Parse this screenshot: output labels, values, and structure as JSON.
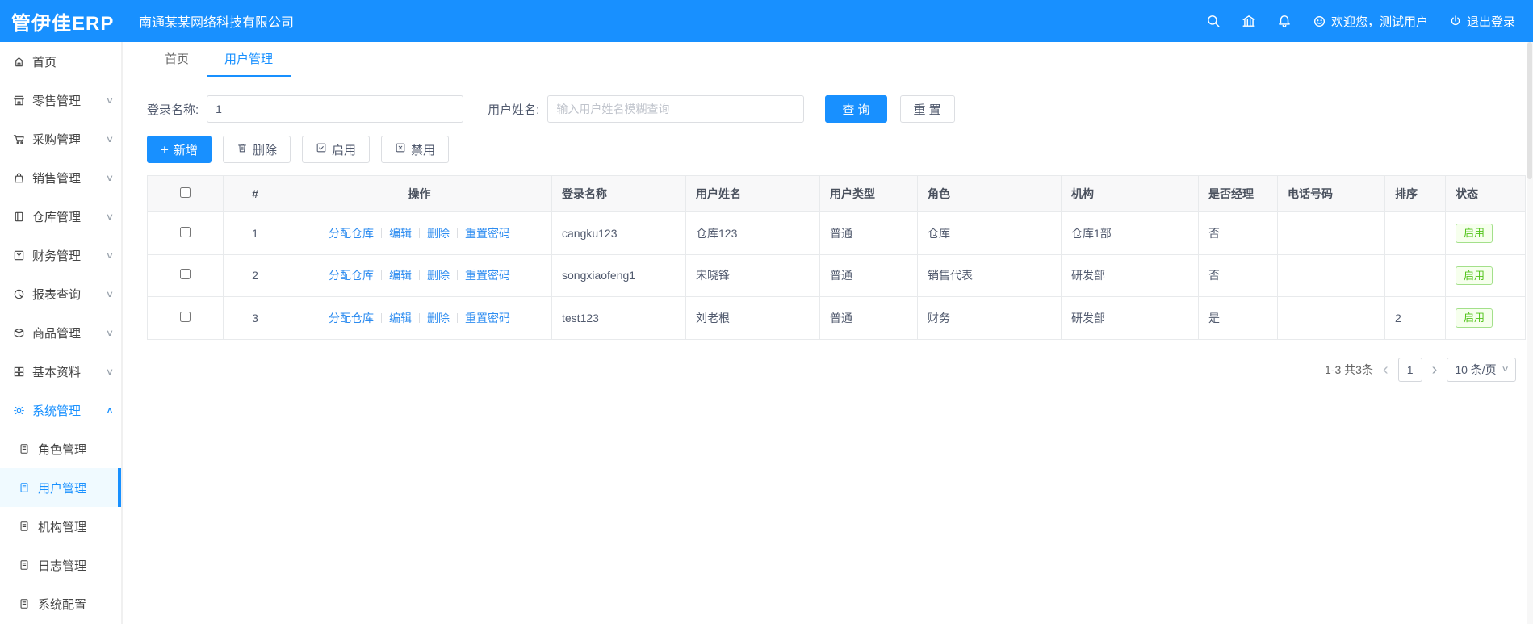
{
  "topbar": {
    "logo": "管伊佳ERP",
    "company": "南通某某网络科技有限公司",
    "welcome": "欢迎您，测试用户",
    "logout": "退出登录"
  },
  "icons": {
    "chevron_down": "∨",
    "chevron_up": "∧",
    "plus": "+",
    "prev": "‹",
    "next": "›",
    "select_arrow": "∨"
  },
  "sidebar": {
    "items": [
      {
        "label": "首页"
      },
      {
        "label": "零售管理"
      },
      {
        "label": "采购管理"
      },
      {
        "label": "销售管理"
      },
      {
        "label": "仓库管理"
      },
      {
        "label": "财务管理"
      },
      {
        "label": "报表查询"
      },
      {
        "label": "商品管理"
      },
      {
        "label": "基本资料"
      },
      {
        "label": "系统管理"
      }
    ],
    "submenu": [
      {
        "label": "角色管理"
      },
      {
        "label": "用户管理"
      },
      {
        "label": "机构管理"
      },
      {
        "label": "日志管理"
      },
      {
        "label": "系统配置"
      }
    ]
  },
  "tabs": [
    {
      "label": "首页"
    },
    {
      "label": "用户管理"
    }
  ],
  "search": {
    "login_label": "登录名称:",
    "login_value": "1",
    "name_label": "用户姓名:",
    "name_placeholder": "输入用户姓名模糊查询",
    "query_label": "查 询",
    "reset_label": "重 置"
  },
  "toolbar": {
    "add_label": "新增",
    "delete_label": "删除",
    "enable_label": "启用",
    "disable_label": "禁用"
  },
  "table": {
    "headers": [
      "#",
      "操作",
      "登录名称",
      "用户姓名",
      "用户类型",
      "角色",
      "机构",
      "是否经理",
      "电话号码",
      "排序",
      "状态"
    ],
    "action_links": [
      "分配仓库",
      "编辑",
      "删除",
      "重置密码"
    ],
    "rows": [
      {
        "num": "1",
        "login": "cangku123",
        "name": "仓库123",
        "type": "普通",
        "role": "仓库",
        "org": "仓库1部",
        "manager": "否",
        "phone": "",
        "sort": "",
        "status": "启用"
      },
      {
        "num": "2",
        "login": "songxiaofeng1",
        "name": "宋晓锋",
        "type": "普通",
        "role": "销售代表",
        "org": "研发部",
        "manager": "否",
        "phone": "",
        "sort": "",
        "status": "启用"
      },
      {
        "num": "3",
        "login": "test123",
        "name": "刘老根",
        "type": "普通",
        "role": "财务",
        "org": "研发部",
        "manager": "是",
        "phone": "",
        "sort": "2",
        "status": "启用"
      }
    ]
  },
  "pagination": {
    "total": "1-3 共3条",
    "page": "1",
    "page_size": "10 条/页"
  }
}
